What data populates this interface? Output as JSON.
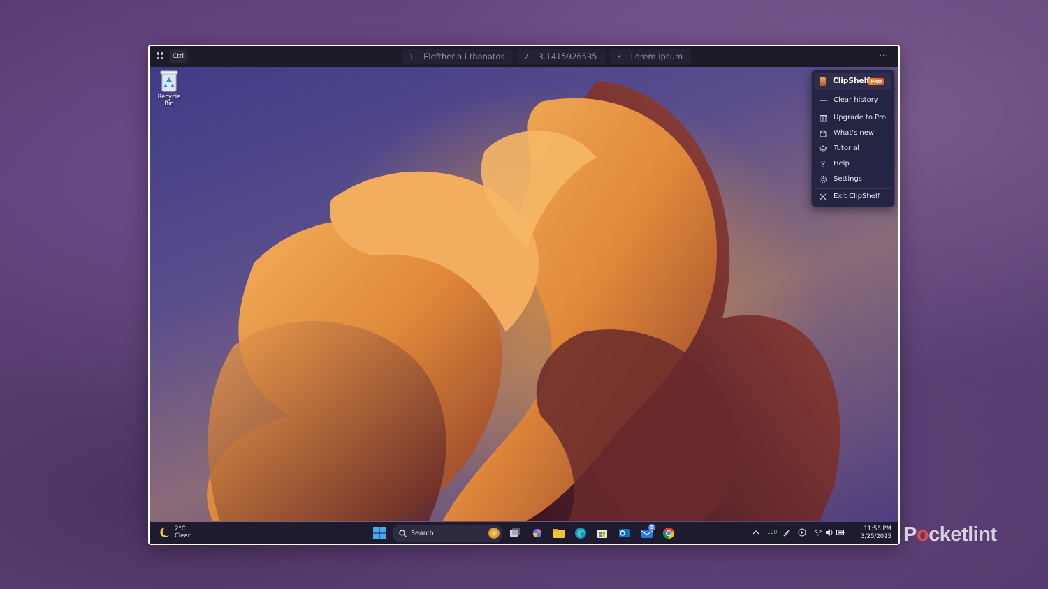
{
  "top_bar": {
    "ctrl_label": "Ctrl",
    "clips": [
      {
        "num": "1",
        "text": "Eleftheria i thanatos"
      },
      {
        "num": "2",
        "text": "3.1415926535"
      },
      {
        "num": "3",
        "text": "Lorem ipsum"
      }
    ],
    "more_label": "···"
  },
  "desktop": {
    "recycle_bin_label": "Recycle Bin"
  },
  "menu": {
    "app_name": "ClipShelf",
    "badge": "PRO",
    "items": [
      {
        "label": "Clear history",
        "icon": "minus-icon"
      },
      {
        "label": "Upgrade to Pro",
        "icon": "gift-icon"
      },
      {
        "label": "What's new",
        "icon": "gift-open-icon"
      },
      {
        "label": "Tutorial",
        "icon": "graduation-cap-icon"
      },
      {
        "label": "Help",
        "icon": "question-icon"
      },
      {
        "label": "Settings",
        "icon": "gear-icon"
      },
      {
        "label": "Exit ClipShelf",
        "icon": "close-icon"
      }
    ]
  },
  "taskbar": {
    "weather_temp": "2°C",
    "weather_desc": "Clear",
    "search_placeholder": "Search",
    "mail_badge": "5",
    "battery_level": "100",
    "time": "11:56 PM",
    "date": "3/25/2025"
  },
  "watermark": {
    "brand_prefix": "P",
    "brand_o": "o",
    "brand_suffix": "cketlint"
  },
  "colors": {
    "accent_orange": "#e88a3a",
    "menu_bg": "#252442",
    "taskbar_bg": "#1f1b2e",
    "topbar_bg": "#1c1b2a"
  }
}
